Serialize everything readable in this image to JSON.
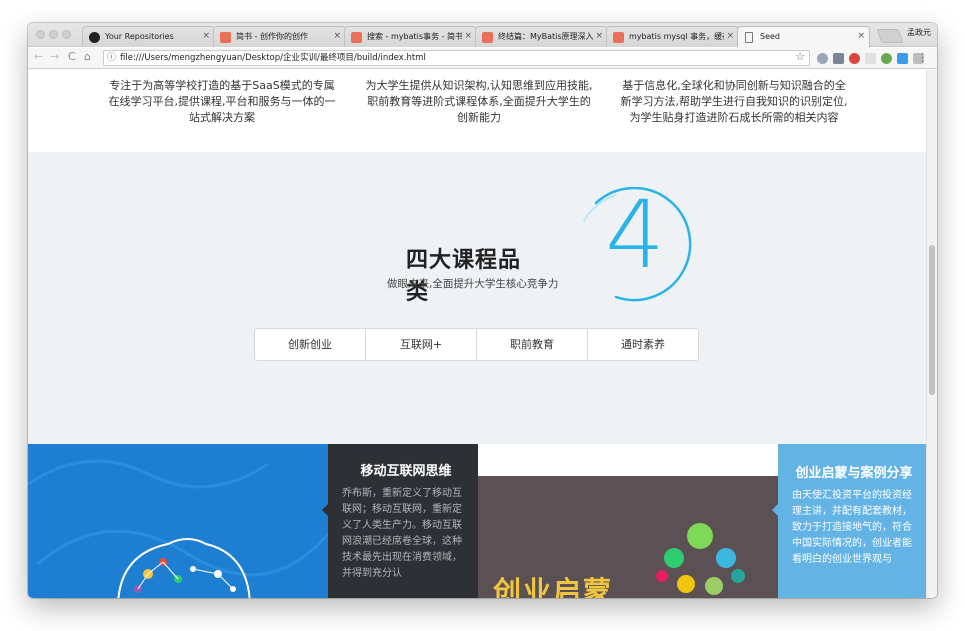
{
  "browser": {
    "tabs": [
      {
        "title": "Your Repositories",
        "icon": "github-icon"
      },
      {
        "title": "简书 - 创作你的创作",
        "icon": "jianshu-icon"
      },
      {
        "title": "搜索 - mybatis事务 - 简书",
        "icon": "jianshu-icon"
      },
      {
        "title": "终结篇：MyBatis原理深入解",
        "icon": "jianshu-icon"
      },
      {
        "title": "mybatis mysql 事务，缓存",
        "icon": "jianshu-icon"
      },
      {
        "title": "Seed",
        "icon": "document-icon"
      }
    ],
    "tab_close": "×",
    "user_name": "孟政元",
    "url": "file:///Users/mengzhengyuan/Desktop/企业实训/最终项目/build/index.html",
    "nav": {
      "back": "←",
      "forward": "→",
      "reload": "C",
      "home": "⌂"
    },
    "star": "☆",
    "info": "ⓘ",
    "menu": "⋮"
  },
  "intro": {
    "col1": "专注于为高等学校打造的基于SaaS模式的专属在线学习平台,提供课程,平台和服务与一体的一站式解决方案",
    "col2": "为大学生提供从知识架构,认知思维到应用技能,职前教育等进阶式课程体系,全面提升大学生的创新能力",
    "col3": "基于信息化,全球化和协同创新与知识融合的全新学习方法,帮助学生进行自我知识的识别定位, 为学生贴身打造进阶石成长所需的相关内容"
  },
  "categories": {
    "title": "四大课程品类",
    "subtitle": "做眼未来,全面提升大学生核心竞争力",
    "big_number": "4",
    "tabs": [
      "创新创业",
      "互联网+",
      "职前教育",
      "通时素养"
    ]
  },
  "tiles": {
    "mobile": {
      "title": "移动互联网思维",
      "body": "乔布斯，重新定义了移动互联网；移动互联网，重新定义了人类生产力。移动互联网浪潮已经席卷全球，这种技术最先出现在消费领域，并得到充分认"
    },
    "startup_overlay": "创业启蒙",
    "startup": {
      "title": "创业启蒙与案例分享",
      "body": "由天使汇投资平台的投资经理主讲，并配有配套教材，致力于打造接地气的，符合中国实际情况的，创业者能看明白的创业世界观与"
    }
  },
  "colors": {
    "accent": "#2ab3e8",
    "tile_blue": "#1e7fd2",
    "tile_dark": "#2d3135",
    "tile_mauve": "#5b5155",
    "tile_sky": "#63b4e4",
    "band": "#eef2f5"
  }
}
